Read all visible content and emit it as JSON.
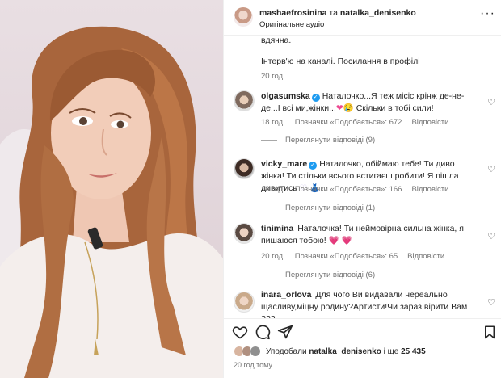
{
  "header": {
    "author": "mashaefrosinina",
    "joiner": "та",
    "coauthor": "natalka_denisenko",
    "audio": "Оригінальне аудіо",
    "more": "···"
  },
  "caption": {
    "line1": "вдячна.",
    "line2": "Інтерв'ю на каналі. Посилання в профілі",
    "time": "20 год."
  },
  "comments": [
    {
      "user": "olgasumska",
      "verified": true,
      "text": "Наталочко...Я теж місіс крінж де-не-де...І всі ми,жінки...",
      "emoji_tail": " Скільки в тобі сили!",
      "time": "18 год.",
      "likes": "Позначки «Подобається»: 672",
      "reply": "Відповісти",
      "view_replies": "Переглянути відповіді (9)"
    },
    {
      "user": "vicky_mare",
      "verified": true,
      "text": "Наталочко, обіймаю тебе! Ти диво жінка! Ти стільки всього встигаєш робити! Я пішла дивитись",
      "time": "18 год.",
      "likes": "Позначки «Подобається»: 166",
      "reply": "Відповісти",
      "view_replies": "Переглянути відповіді (1)"
    },
    {
      "user": "tinimina",
      "verified": false,
      "text": "Наталочка! Ти неймовірна сильна жінка, я пишаюся тобою!",
      "time": "20 год.",
      "likes": "Позначки «Подобається»: 65",
      "reply": "Відповісти",
      "view_replies": "Переглянути відповіді (6)"
    },
    {
      "user": "inara_orlova",
      "verified": false,
      "text": "Для чого Ви видавали нереально щасливу,міцну родину?Артисти!Чи зараз вірити Вам ???"
    }
  ],
  "likes_summary": {
    "prefix": "Уподобали",
    "user": "natalka_denisenko",
    "middle": "і ще",
    "count": "25 435"
  },
  "time_ago": "20 год тому",
  "colors": {
    "verified": "#1d9bf0",
    "meta": "#737373",
    "heart": "#ed4690"
  }
}
